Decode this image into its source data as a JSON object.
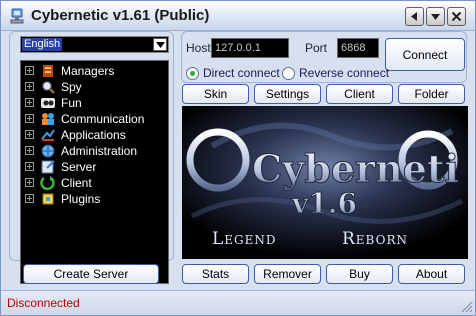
{
  "window": {
    "title": "Cybernetic v1.61 (Public)"
  },
  "language": {
    "selected": "English"
  },
  "tree": {
    "items": [
      {
        "label": "Managers",
        "icon": "managers-icon"
      },
      {
        "label": "Spy",
        "icon": "spy-icon"
      },
      {
        "label": "Fun",
        "icon": "fun-icon"
      },
      {
        "label": "Communication",
        "icon": "communication-icon"
      },
      {
        "label": "Applications",
        "icon": "applications-icon"
      },
      {
        "label": "Administration",
        "icon": "administration-icon"
      },
      {
        "label": "Server",
        "icon": "server-icon"
      },
      {
        "label": "Client",
        "icon": "client-icon"
      },
      {
        "label": "Plugins",
        "icon": "plugins-icon"
      }
    ]
  },
  "connection": {
    "host_label": "Host",
    "host_value": "127.0.0.1",
    "port_label": "Port",
    "port_value": "6868",
    "connect_label": "Connect",
    "direct_label": "Direct connect",
    "reverse_label": "Reverse connect",
    "mode": "direct"
  },
  "tabs": {
    "skin": "Skin",
    "settings": "Settings",
    "client": "Client",
    "folder": "Folder"
  },
  "banner": {
    "line1": "Cyberneti",
    "version": "v1.6",
    "legend": "Legend",
    "reborn": "Reborn"
  },
  "bottom": {
    "create_server": "Create Server",
    "stats": "Stats",
    "remover": "Remover",
    "buy": "Buy",
    "about": "About"
  },
  "status": {
    "text": "Disconnected",
    "color": "#c00000"
  },
  "colors": {
    "accent": "#3d5fa7",
    "panel": "#d7e0ee",
    "radio_checked": "#34a834"
  }
}
